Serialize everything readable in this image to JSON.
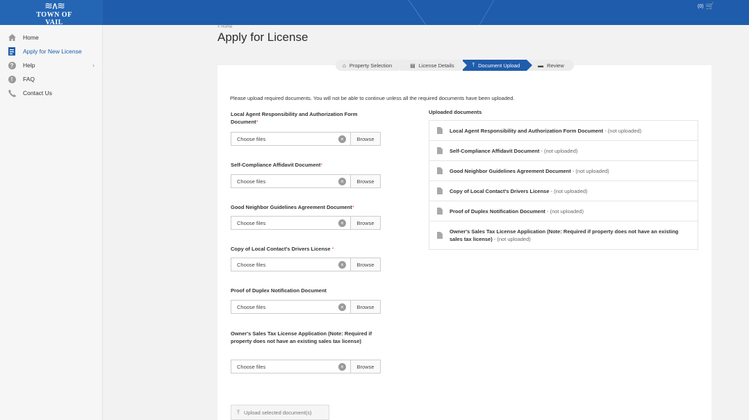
{
  "header": {
    "logo_mark": "≋∧≋",
    "logo_text": "TOWN OF VAIL",
    "cart_count": "(0)",
    "cart_icon": "cart-icon"
  },
  "sidebar": {
    "items": [
      {
        "label": "Home",
        "icon": "home-icon"
      },
      {
        "label": "Apply for New License",
        "icon": "license-icon"
      },
      {
        "label": "Help",
        "icon": "help-icon"
      },
      {
        "label": "FAQ",
        "icon": "info-icon"
      },
      {
        "label": "Contact Us",
        "icon": "phone-icon"
      }
    ],
    "help_chevron": "›"
  },
  "breadcrumb": "< Home",
  "page_title": "Apply for License",
  "stepper": {
    "steps": [
      {
        "label": "Property Selection",
        "icon": "home-icon"
      },
      {
        "label": "License Details",
        "icon": "document-icon"
      },
      {
        "label": "Document Upload",
        "icon": "upload-icon"
      },
      {
        "label": "Review",
        "icon": "list-icon"
      }
    ],
    "active": "Document Upload"
  },
  "instructions": "Please upload required documents. You will not be able to continue unless all the required documents have been uploaded.",
  "upload_form": {
    "fields": [
      {
        "label": "Local Agent Responsibility and Authorization Form Document",
        "required": "*",
        "placeholder": "Choose files",
        "browse": "Browse"
      },
      {
        "label": "Self-Compliance Affidavit Document",
        "required": "*",
        "placeholder": "Choose files",
        "browse": "Browse"
      },
      {
        "label": "Good Neighbor Guidelines Agreement Document",
        "required": "*",
        "placeholder": "Choose files",
        "browse": "Browse"
      },
      {
        "label": "Copy of Local Contact's Drivers License ",
        "required": "*",
        "placeholder": "Choose files",
        "browse": "Browse"
      },
      {
        "label": "Proof of Duplex Notification Document",
        "required": "",
        "placeholder": "Choose files",
        "browse": "Browse"
      },
      {
        "label": "Owner's Sales Tax License Application (Note: Required if property does not have an existing sales tax license)",
        "required": "",
        "placeholder": "Choose files",
        "browse": "Browse"
      }
    ],
    "clear_glyph": "×",
    "upload_button": "Upload selected document(s)"
  },
  "uploaded": {
    "title": "Uploaded documents",
    "items": [
      {
        "name": "Local Agent Responsibility and Authorization Form Document",
        "status": " - (not uploaded)"
      },
      {
        "name": "Self-Compliance Affidavit Document",
        "status": " - (not uploaded)"
      },
      {
        "name": "Good Neighbor Guidelines Agreement Document",
        "status": " - (not uploaded)"
      },
      {
        "name": "Copy of Local Contact's Drivers License",
        "status": " - (not uploaded)"
      },
      {
        "name": "Proof of Duplex Notification Document",
        "status": " - (not uploaded)"
      },
      {
        "name": "Owner's Sales Tax License Application (Note: Required if property does not have an existing sales tax license)",
        "status": " - (not uploaded)"
      }
    ]
  },
  "colors": {
    "brand": "#1f5cab",
    "required": "#d9534f"
  }
}
